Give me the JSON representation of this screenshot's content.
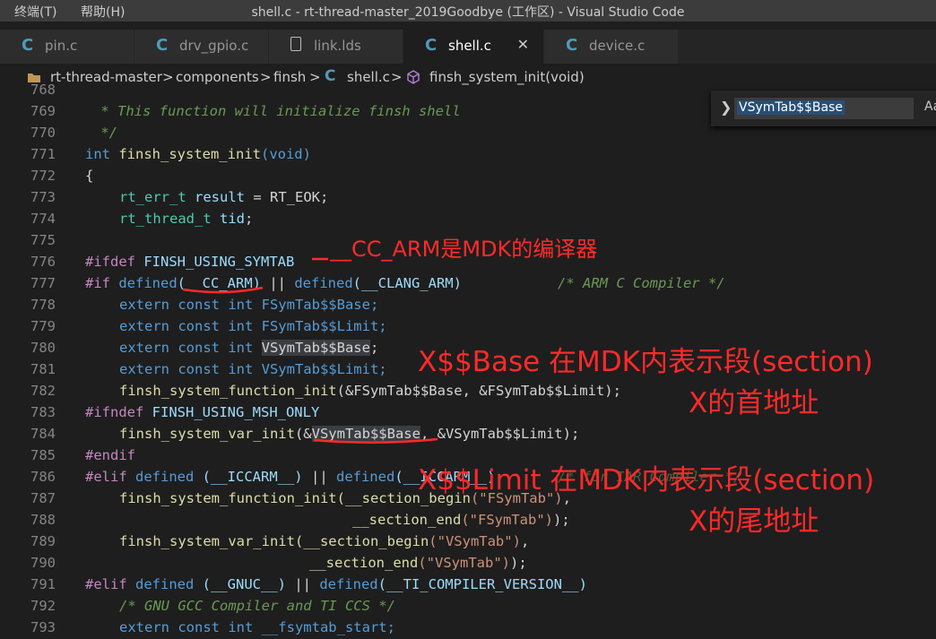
{
  "menu": {
    "terminal": "终端(T)",
    "help": "帮助(H)"
  },
  "window": {
    "title": "shell.c - rt-thread-master_2019Goodbye (工作区) - Visual Studio Code"
  },
  "tabs": [
    {
      "label": "pin.c",
      "icon": "c-file-icon"
    },
    {
      "label": "drv_gpio.c",
      "icon": "c-file-icon"
    },
    {
      "label": "link.lds",
      "icon": "file-icon"
    },
    {
      "label": "shell.c",
      "icon": "c-file-icon",
      "active": true
    },
    {
      "label": "device.c",
      "icon": "c-file-icon"
    }
  ],
  "tab_icon_glyph": "C",
  "close_glyph": "✕",
  "breadcrumb": {
    "root": "rt-thread-master",
    "folder1": "components",
    "folder2": "finsh",
    "file": "shell.c",
    "symbol": "finsh_system_init(void)",
    "sep": ">"
  },
  "find": {
    "query": "VSymTab$$Base",
    "case_label": "Aa"
  },
  "line_numbers": [
    "768",
    "769",
    "770",
    "771",
    "772",
    "773",
    "774",
    "775",
    "776",
    "777",
    "778",
    "779",
    "780",
    "781",
    "782",
    "783",
    "784",
    "785",
    "786",
    "787",
    "788",
    "789",
    "790",
    "791",
    "792",
    "793"
  ],
  "code": {
    "l769": " * This function will initialize finsh shell",
    "l770": " */",
    "l771_kw": "int",
    "l771_fn": "finsh_system_init",
    "l771_rest": "(void)",
    "l772": "{",
    "l773_ty": "rt_err_t",
    "l773_var": "result",
    "l773_rest": " = RT_EOK;",
    "l774_ty": "rt_thread_t",
    "l774_var": "tid",
    "l774_rest": ";",
    "l776_pre": "#ifdef",
    "l776_id": "FINSH_USING_SYMTAB",
    "l777_pre": "#if",
    "l777_a": "defined",
    "l777_b": "(__CC_ARM)",
    "l777_c": " || ",
    "l777_d": "defined",
    "l777_e": "(__CLANG_ARM)",
    "l777_cmt": "/* ARM C Compiler */",
    "l778": "extern const int FSymTab$$Base;",
    "l779": "extern const int FSymTab$$Limit;",
    "l780_a": "extern const int ",
    "l780_b": "VSymTab$$Base",
    "l780_c": ";",
    "l781": "extern const int VSymTab$$Limit;",
    "l782_fn": "finsh_system_function_init",
    "l782_rest": "(&FSymTab$$Base, &FSymTab$$Limit);",
    "l783_pre": "#ifndef",
    "l783_id": "FINSH_USING_MSH_ONLY",
    "l784_fn": "finsh_system_var_init",
    "l784_a": "(&",
    "l784_b": "VSymTab$$Base",
    "l784_c": ", &VSymTab$$Limit);",
    "l785": "#endif",
    "l786_pre": "#elif",
    "l786_a": " defined",
    "l786_b": " (__ICCARM__)",
    "l786_c": " || ",
    "l786_d": "defined",
    "l786_e": "(__ICCARM__)",
    "l786_cmt": "/* for IAR Compiler */",
    "l787_fn": "finsh_system_function_init",
    "l787_a": "(__section_begin",
    "l787_str": "(\"FSymTab\")",
    "l787_c": ",",
    "l788_a": "__section_end",
    "l788_str": "(\"FSymTab\")",
    "l788_c": ");",
    "l789_fn": "finsh_system_var_init",
    "l789_a": "(__section_begin",
    "l789_str": "(\"VSymTab\")",
    "l789_c": ",",
    "l790_a": "__section_end",
    "l790_str": "(\"VSymTab\")",
    "l790_c": ");",
    "l791_pre": "#elif",
    "l791_a": " defined",
    "l791_b": " (__GNUC__)",
    "l791_c": " || ",
    "l791_d": "defined",
    "l791_e": "(__TI_COMPILER_VERSION__)",
    "l792": "/* GNU GCC Compiler and TI CCS */",
    "l793": "extern const int __fsymtab_start;"
  },
  "annotations": {
    "cc_arm": "__CC_ARM是MDK的编译器",
    "base_line1": "X$$Base 在MDK内表示段(section)",
    "base_line2": "X的首地址",
    "limit_line1": "X$$Limit 在MDK内表示段(section)",
    "limit_line2": "X的尾地址"
  },
  "colors": {
    "annotation": "#ff2a2a",
    "editor_bg": "#1e1e1e",
    "selection": "#264f78"
  }
}
